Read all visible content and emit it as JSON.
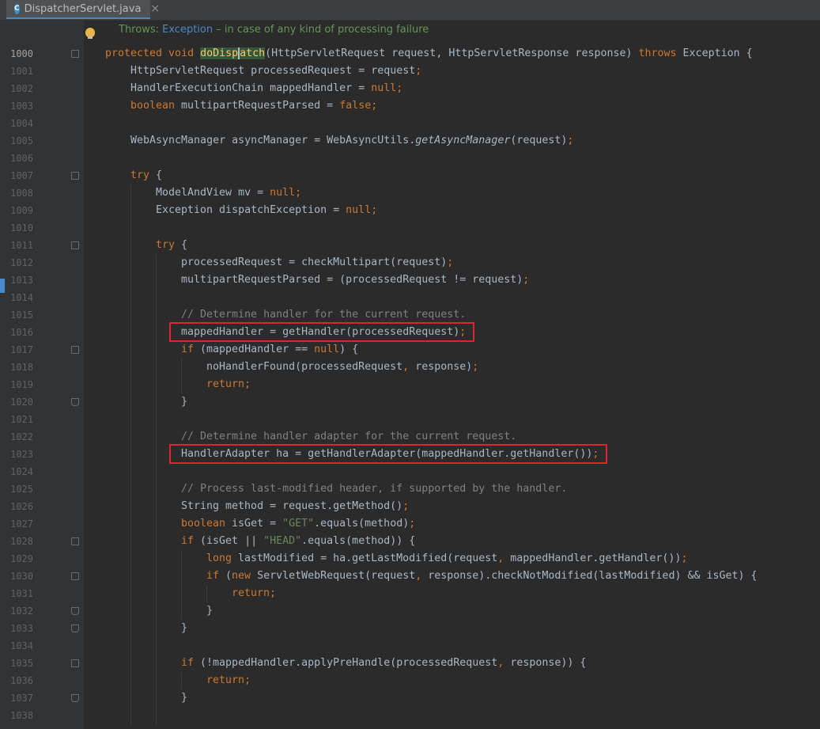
{
  "tab": {
    "icon_letter": "C",
    "title": "DispatcherServlet.java",
    "close_glyph": "×"
  },
  "doc": {
    "prefix": "Throws: ",
    "link": "Exception",
    "suffix": " – in case of any kind of processing failure"
  },
  "lines": [
    {
      "n": "1000",
      "fold": "open",
      "indent": 0,
      "current": true,
      "parts": [
        [
          "kw",
          "protected void "
        ],
        [
          "fnhl",
          "doDisp"
        ],
        [
          "caret",
          ""
        ],
        [
          "fnhl",
          "atch"
        ],
        [
          "",
          "(HttpServletRequest request, HttpServletResponse response) "
        ],
        [
          "kw",
          "throws "
        ],
        [
          "",
          "Exception {"
        ]
      ]
    },
    {
      "n": "1001",
      "indent": 1,
      "parts": [
        [
          "",
          "HttpServletRequest processedRequest = request"
        ],
        [
          "kw",
          ";"
        ]
      ]
    },
    {
      "n": "1002",
      "indent": 1,
      "parts": [
        [
          "",
          "HandlerExecutionChain mappedHandler = "
        ],
        [
          "kw",
          "null;"
        ]
      ]
    },
    {
      "n": "1003",
      "indent": 1,
      "parts": [
        [
          "kw",
          "boolean "
        ],
        [
          "",
          "multipartRequestParsed = "
        ],
        [
          "kw",
          "false;"
        ]
      ]
    },
    {
      "n": "1004",
      "indent": 1,
      "parts": []
    },
    {
      "n": "1005",
      "indent": 1,
      "parts": [
        [
          "",
          "WebAsyncManager asyncManager = WebAsyncUtils."
        ],
        [
          "it",
          "getAsyncManager"
        ],
        [
          "",
          "(request)"
        ],
        [
          "kw",
          ";"
        ]
      ]
    },
    {
      "n": "1006",
      "indent": 1,
      "parts": []
    },
    {
      "n": "1007",
      "fold": "open",
      "indent": 1,
      "parts": [
        [
          "kw",
          "try "
        ],
        [
          "",
          "{"
        ]
      ]
    },
    {
      "n": "1008",
      "indent": 2,
      "parts": [
        [
          "",
          "ModelAndView mv = "
        ],
        [
          "kw",
          "null;"
        ]
      ]
    },
    {
      "n": "1009",
      "indent": 2,
      "parts": [
        [
          "",
          "Exception dispatchException = "
        ],
        [
          "kw",
          "null;"
        ]
      ]
    },
    {
      "n": "1010",
      "indent": 2,
      "parts": []
    },
    {
      "n": "1011",
      "fold": "open",
      "indent": 2,
      "parts": [
        [
          "kw",
          "try "
        ],
        [
          "",
          "{"
        ]
      ]
    },
    {
      "n": "1012",
      "indent": 3,
      "parts": [
        [
          "",
          "processedRequest = checkMultipart(request)"
        ],
        [
          "kw",
          ";"
        ]
      ]
    },
    {
      "n": "1013",
      "indent": 3,
      "parts": [
        [
          "",
          "multipartRequestParsed = (processedRequest != request)"
        ],
        [
          "kw",
          ";"
        ]
      ]
    },
    {
      "n": "1014",
      "indent": 3,
      "parts": []
    },
    {
      "n": "1015",
      "indent": 3,
      "parts": [
        [
          "cmt",
          "// Determine handler for the current request."
        ]
      ]
    },
    {
      "n": "1016",
      "indent": 3,
      "parts": [
        [
          "",
          "mappedHandler = getHandler(processedRequest)"
        ],
        [
          "kw",
          ";"
        ]
      ]
    },
    {
      "n": "1017",
      "fold": "open",
      "indent": 3,
      "parts": [
        [
          "kw",
          "if "
        ],
        [
          "",
          "(mappedHandler == "
        ],
        [
          "kw",
          "null"
        ],
        [
          "",
          ") {"
        ]
      ]
    },
    {
      "n": "1018",
      "indent": 4,
      "parts": [
        [
          "",
          "noHandlerFound(processedRequest"
        ],
        [
          "kw",
          ", "
        ],
        [
          "",
          "response)"
        ],
        [
          "kw",
          ";"
        ]
      ]
    },
    {
      "n": "1019",
      "indent": 4,
      "parts": [
        [
          "kw",
          "return;"
        ]
      ]
    },
    {
      "n": "1020",
      "fold": "end",
      "indent": 3,
      "parts": [
        [
          "",
          "}"
        ]
      ]
    },
    {
      "n": "1021",
      "indent": 3,
      "parts": []
    },
    {
      "n": "1022",
      "indent": 3,
      "parts": [
        [
          "cmt",
          "// Determine handler adapter for the current request."
        ]
      ]
    },
    {
      "n": "1023",
      "indent": 3,
      "parts": [
        [
          "",
          "HandlerAdapter ha = getHandlerAdapter(mappedHandler.getHandler())"
        ],
        [
          "kw",
          ";"
        ]
      ]
    },
    {
      "n": "1024",
      "indent": 3,
      "parts": []
    },
    {
      "n": "1025",
      "indent": 3,
      "parts": [
        [
          "cmt",
          "// Process last-modified header, if supported by the handler."
        ]
      ]
    },
    {
      "n": "1026",
      "indent": 3,
      "parts": [
        [
          "",
          "String method = request.getMethod()"
        ],
        [
          "kw",
          ";"
        ]
      ]
    },
    {
      "n": "1027",
      "indent": 3,
      "parts": [
        [
          "kw",
          "boolean "
        ],
        [
          "",
          "isGet = "
        ],
        [
          "str",
          "\"GET\""
        ],
        [
          "",
          ".equals(method)"
        ],
        [
          "kw",
          ";"
        ]
      ]
    },
    {
      "n": "1028",
      "fold": "open",
      "indent": 3,
      "parts": [
        [
          "kw",
          "if "
        ],
        [
          "",
          "(isGet || "
        ],
        [
          "str",
          "\"HEAD\""
        ],
        [
          "",
          ".equals(method)) {"
        ]
      ]
    },
    {
      "n": "1029",
      "indent": 4,
      "parts": [
        [
          "kw",
          "long "
        ],
        [
          "",
          "lastModified = ha.getLastModified(request"
        ],
        [
          "kw",
          ", "
        ],
        [
          "",
          "mappedHandler.getHandler())"
        ],
        [
          "kw",
          ";"
        ]
      ]
    },
    {
      "n": "1030",
      "fold": "open",
      "indent": 4,
      "parts": [
        [
          "kw",
          "if "
        ],
        [
          "",
          "("
        ],
        [
          "kw",
          "new "
        ],
        [
          "",
          "ServletWebRequest(request"
        ],
        [
          "kw",
          ", "
        ],
        [
          "",
          "response).checkNotModified(lastModified) && isGet) {"
        ]
      ]
    },
    {
      "n": "1031",
      "indent": 5,
      "parts": [
        [
          "kw",
          "return;"
        ]
      ]
    },
    {
      "n": "1032",
      "fold": "end",
      "indent": 4,
      "parts": [
        [
          "",
          "}"
        ]
      ]
    },
    {
      "n": "1033",
      "fold": "end",
      "indent": 3,
      "parts": [
        [
          "",
          "}"
        ]
      ]
    },
    {
      "n": "1034",
      "indent": 3,
      "parts": []
    },
    {
      "n": "1035",
      "fold": "open",
      "indent": 3,
      "parts": [
        [
          "kw",
          "if "
        ],
        [
          "",
          "(!mappedHandler.applyPreHandle(processedRequest"
        ],
        [
          "kw",
          ", "
        ],
        [
          "",
          "response)) {"
        ]
      ]
    },
    {
      "n": "1036",
      "indent": 4,
      "parts": [
        [
          "kw",
          "return;"
        ]
      ]
    },
    {
      "n": "1037",
      "fold": "end",
      "indent": 3,
      "parts": [
        [
          "",
          "}"
        ]
      ]
    },
    {
      "n": "1038",
      "indent": 3,
      "parts": []
    }
  ],
  "highlight_lines": [
    "1016",
    "1023"
  ],
  "colors": {
    "keyword": "#cc7832",
    "method": "#ffc66d",
    "string": "#6a8759",
    "comment": "#808080",
    "highlight_box": "#e0242b"
  }
}
